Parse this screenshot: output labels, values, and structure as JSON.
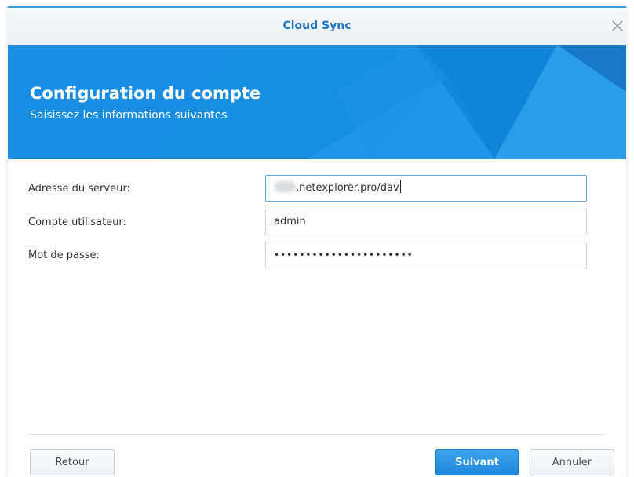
{
  "window": {
    "title": "Cloud Sync",
    "close_icon": "close-icon"
  },
  "banner": {
    "title": "Configuration du compte",
    "subtitle": "Saisissez les informations suivantes",
    "color": "#168ee2"
  },
  "form": {
    "server": {
      "label": "Adresse du serveur:",
      "value": ".netexplorer.pro/dav"
    },
    "user": {
      "label": "Compte utilisateur:",
      "value": "admin"
    },
    "password": {
      "label": "Mot de passe:",
      "value": "••••••••••••••••••••••"
    }
  },
  "footer": {
    "back_label": "Retour",
    "next_label": "Suivant",
    "cancel_label": "Annuler"
  }
}
